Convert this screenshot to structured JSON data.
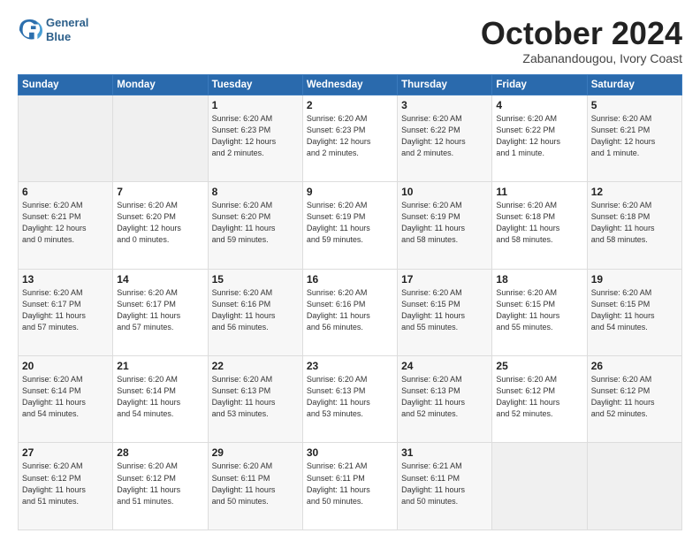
{
  "header": {
    "logo_line1": "General",
    "logo_line2": "Blue",
    "month": "October 2024",
    "location": "Zabanandougou, Ivory Coast"
  },
  "weekdays": [
    "Sunday",
    "Monday",
    "Tuesday",
    "Wednesday",
    "Thursday",
    "Friday",
    "Saturday"
  ],
  "weeks": [
    [
      {
        "day": "",
        "info": ""
      },
      {
        "day": "",
        "info": ""
      },
      {
        "day": "1",
        "info": "Sunrise: 6:20 AM\nSunset: 6:23 PM\nDaylight: 12 hours\nand 2 minutes."
      },
      {
        "day": "2",
        "info": "Sunrise: 6:20 AM\nSunset: 6:23 PM\nDaylight: 12 hours\nand 2 minutes."
      },
      {
        "day": "3",
        "info": "Sunrise: 6:20 AM\nSunset: 6:22 PM\nDaylight: 12 hours\nand 2 minutes."
      },
      {
        "day": "4",
        "info": "Sunrise: 6:20 AM\nSunset: 6:22 PM\nDaylight: 12 hours\nand 1 minute."
      },
      {
        "day": "5",
        "info": "Sunrise: 6:20 AM\nSunset: 6:21 PM\nDaylight: 12 hours\nand 1 minute."
      }
    ],
    [
      {
        "day": "6",
        "info": "Sunrise: 6:20 AM\nSunset: 6:21 PM\nDaylight: 12 hours\nand 0 minutes."
      },
      {
        "day": "7",
        "info": "Sunrise: 6:20 AM\nSunset: 6:20 PM\nDaylight: 12 hours\nand 0 minutes."
      },
      {
        "day": "8",
        "info": "Sunrise: 6:20 AM\nSunset: 6:20 PM\nDaylight: 11 hours\nand 59 minutes."
      },
      {
        "day": "9",
        "info": "Sunrise: 6:20 AM\nSunset: 6:19 PM\nDaylight: 11 hours\nand 59 minutes."
      },
      {
        "day": "10",
        "info": "Sunrise: 6:20 AM\nSunset: 6:19 PM\nDaylight: 11 hours\nand 58 minutes."
      },
      {
        "day": "11",
        "info": "Sunrise: 6:20 AM\nSunset: 6:18 PM\nDaylight: 11 hours\nand 58 minutes."
      },
      {
        "day": "12",
        "info": "Sunrise: 6:20 AM\nSunset: 6:18 PM\nDaylight: 11 hours\nand 58 minutes."
      }
    ],
    [
      {
        "day": "13",
        "info": "Sunrise: 6:20 AM\nSunset: 6:17 PM\nDaylight: 11 hours\nand 57 minutes."
      },
      {
        "day": "14",
        "info": "Sunrise: 6:20 AM\nSunset: 6:17 PM\nDaylight: 11 hours\nand 57 minutes."
      },
      {
        "day": "15",
        "info": "Sunrise: 6:20 AM\nSunset: 6:16 PM\nDaylight: 11 hours\nand 56 minutes."
      },
      {
        "day": "16",
        "info": "Sunrise: 6:20 AM\nSunset: 6:16 PM\nDaylight: 11 hours\nand 56 minutes."
      },
      {
        "day": "17",
        "info": "Sunrise: 6:20 AM\nSunset: 6:15 PM\nDaylight: 11 hours\nand 55 minutes."
      },
      {
        "day": "18",
        "info": "Sunrise: 6:20 AM\nSunset: 6:15 PM\nDaylight: 11 hours\nand 55 minutes."
      },
      {
        "day": "19",
        "info": "Sunrise: 6:20 AM\nSunset: 6:15 PM\nDaylight: 11 hours\nand 54 minutes."
      }
    ],
    [
      {
        "day": "20",
        "info": "Sunrise: 6:20 AM\nSunset: 6:14 PM\nDaylight: 11 hours\nand 54 minutes."
      },
      {
        "day": "21",
        "info": "Sunrise: 6:20 AM\nSunset: 6:14 PM\nDaylight: 11 hours\nand 54 minutes."
      },
      {
        "day": "22",
        "info": "Sunrise: 6:20 AM\nSunset: 6:13 PM\nDaylight: 11 hours\nand 53 minutes."
      },
      {
        "day": "23",
        "info": "Sunrise: 6:20 AM\nSunset: 6:13 PM\nDaylight: 11 hours\nand 53 minutes."
      },
      {
        "day": "24",
        "info": "Sunrise: 6:20 AM\nSunset: 6:13 PM\nDaylight: 11 hours\nand 52 minutes."
      },
      {
        "day": "25",
        "info": "Sunrise: 6:20 AM\nSunset: 6:12 PM\nDaylight: 11 hours\nand 52 minutes."
      },
      {
        "day": "26",
        "info": "Sunrise: 6:20 AM\nSunset: 6:12 PM\nDaylight: 11 hours\nand 52 minutes."
      }
    ],
    [
      {
        "day": "27",
        "info": "Sunrise: 6:20 AM\nSunset: 6:12 PM\nDaylight: 11 hours\nand 51 minutes."
      },
      {
        "day": "28",
        "info": "Sunrise: 6:20 AM\nSunset: 6:12 PM\nDaylight: 11 hours\nand 51 minutes."
      },
      {
        "day": "29",
        "info": "Sunrise: 6:20 AM\nSunset: 6:11 PM\nDaylight: 11 hours\nand 50 minutes."
      },
      {
        "day": "30",
        "info": "Sunrise: 6:21 AM\nSunset: 6:11 PM\nDaylight: 11 hours\nand 50 minutes."
      },
      {
        "day": "31",
        "info": "Sunrise: 6:21 AM\nSunset: 6:11 PM\nDaylight: 11 hours\nand 50 minutes."
      },
      {
        "day": "",
        "info": ""
      },
      {
        "day": "",
        "info": ""
      }
    ]
  ]
}
